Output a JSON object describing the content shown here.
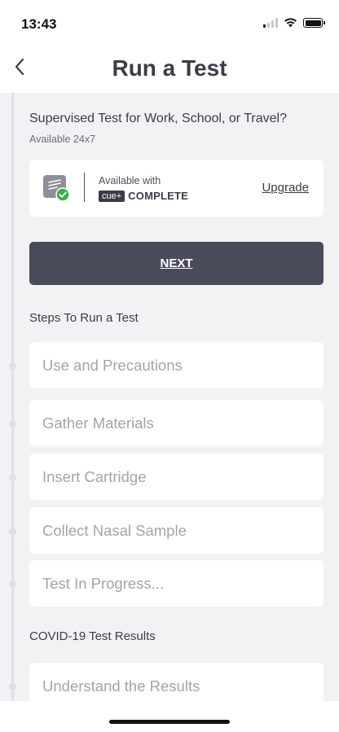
{
  "status_bar": {
    "time": "13:43"
  },
  "header": {
    "title": "Run a Test"
  },
  "supervised": {
    "title": "Supervised Test for Work, School, or Travel?",
    "subtitle": "Available 24x7",
    "available_label": "Available with",
    "brand_badge": "cue+",
    "brand_plan": "COMPLETE",
    "upgrade_label": "Upgrade"
  },
  "next_button": {
    "label": "NEXT"
  },
  "steps_section": {
    "heading": "Steps To Run a Test",
    "steps": [
      "Use and Precautions",
      "Gather Materials",
      "Insert Cartridge",
      "Collect Nasal Sample",
      "Test In Progress..."
    ]
  },
  "results_section": {
    "heading": "COVID-19 Test Results",
    "steps": [
      "Understand the Results"
    ]
  },
  "colors": {
    "background": "#f2f2f4",
    "card": "#ffffff",
    "primary_button": "#4a4b5a",
    "step_text": "#a3a4ac",
    "check_green": "#3fae49"
  },
  "icons": [
    "back-chevron-icon",
    "signal-icon",
    "wifi-icon",
    "battery-icon",
    "product-check-icon"
  ]
}
